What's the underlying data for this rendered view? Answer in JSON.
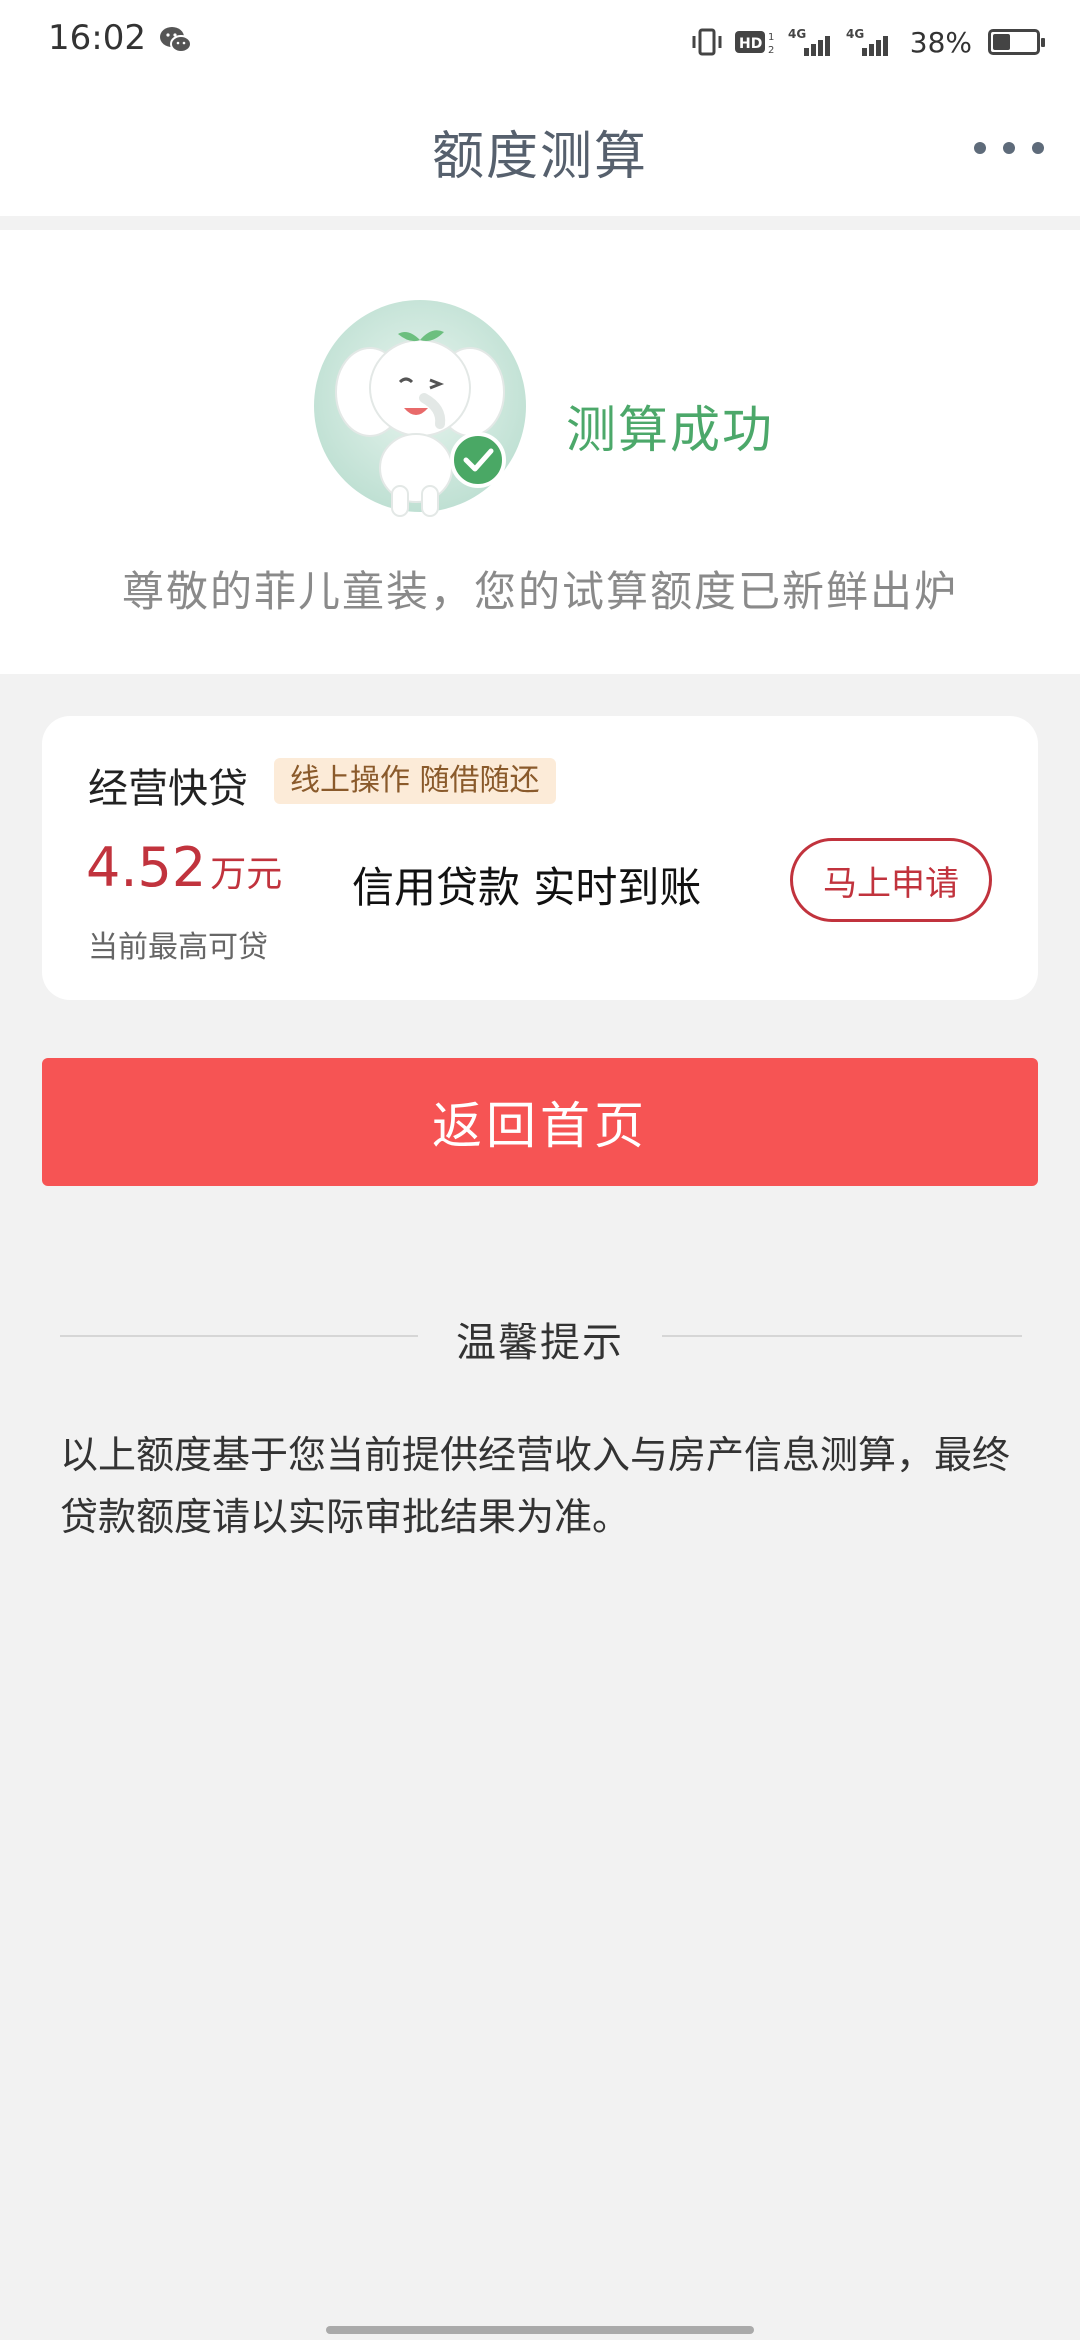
{
  "status_bar": {
    "time": "16:02",
    "wechat_icon": "wechat-icon",
    "signal_1": "HD 4G",
    "signal_2": "4G",
    "battery_percent": "38%",
    "battery_level": 0.38
  },
  "header": {
    "title": "额度测算",
    "more_icon": "more-dots-icon"
  },
  "hero": {
    "mascot_icon": "elephant-mascot-success-icon",
    "status": "测算成功",
    "message": "尊敬的菲儿童装，您的试算额度已新鲜出炉"
  },
  "loan_card": {
    "product_name": "经营快贷",
    "tag": "线上操作 随借随还",
    "amount": "4.52",
    "unit": "万元",
    "amount_label": "当前最高可贷",
    "feature": "信用贷款 实时到账",
    "apply_label": "马上申请"
  },
  "actions": {
    "home_label": "返回首页"
  },
  "tip": {
    "title": "温馨提示",
    "body": "以上额度基于您当前提供经营收入与房产信息测算，最终贷款额度请以实际审批结果为准。"
  },
  "colors": {
    "accent_red": "#f65454",
    "amount_red": "#c1333d",
    "success_green": "#4ca86a",
    "tag_bg": "#fcebd8"
  }
}
